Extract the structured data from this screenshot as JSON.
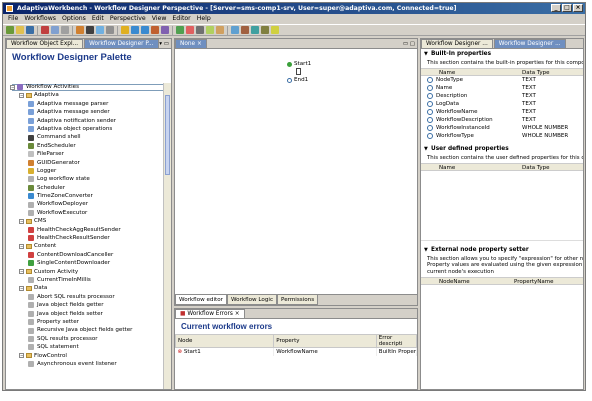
{
  "window": {
    "title": "AdaptivaWorkbench - Workflow Designer Perspective - [Server=sms-comp1-srv, User=super@adaptiva.com, Connected=true]",
    "controls": [
      "_",
      "□",
      "×"
    ]
  },
  "menu": [
    "File",
    "Workflows",
    "Options",
    "Edit",
    "Perspective",
    "View",
    "Editor",
    "Help"
  ],
  "left_panel": {
    "tabs": [
      "Workflow Object Expl...",
      "Workflow Designer P..."
    ],
    "palette_title": "Workflow Designer Palette",
    "tree": [
      {
        "label": "Workflow Activities",
        "level": 0,
        "type": "root",
        "color": "#8a6cc0"
      },
      {
        "label": "Adaptiva",
        "level": 1,
        "type": "folder"
      },
      {
        "label": "Adaptiva message parser",
        "level": 2,
        "type": "item",
        "color": "#7aa0d8"
      },
      {
        "label": "Adaptiva message sender",
        "level": 2,
        "type": "item",
        "color": "#7aa0d8"
      },
      {
        "label": "Adaptiva notification sender",
        "level": 2,
        "type": "item",
        "color": "#7aa0d8"
      },
      {
        "label": "Adaptiva object operations",
        "level": 2,
        "type": "item",
        "color": "#7aa0d8"
      },
      {
        "label": "Command shell",
        "level": 2,
        "type": "item",
        "color": "#404040"
      },
      {
        "label": "EndScheduler",
        "level": 2,
        "type": "item",
        "color": "#6a8a3a"
      },
      {
        "label": "FileParser",
        "level": 2,
        "type": "item",
        "color": "#c0c0c0"
      },
      {
        "label": "GUIDGenerator",
        "level": 2,
        "type": "item",
        "color": "#d08030"
      },
      {
        "label": "Logger",
        "level": 2,
        "type": "item",
        "color": "#d8b030"
      },
      {
        "label": "Log workflow state",
        "level": 2,
        "type": "item",
        "color": "#b0b0b0"
      },
      {
        "label": "Scheduler",
        "level": 2,
        "type": "item",
        "color": "#6a8a3a"
      },
      {
        "label": "TimeZoneConverter",
        "level": 2,
        "type": "item",
        "color": "#3a8ad0"
      },
      {
        "label": "WorkflowDeployer",
        "level": 2,
        "type": "item",
        "color": "#b0b0b0"
      },
      {
        "label": "WorkflowExecutor",
        "level": 2,
        "type": "item",
        "color": "#b0b0b0"
      },
      {
        "label": "CMS",
        "level": 1,
        "type": "folder"
      },
      {
        "label": "HealthCheckAggResultSender",
        "level": 2,
        "type": "item",
        "color": "#d04040"
      },
      {
        "label": "HealthCheckResultSender",
        "level": 2,
        "type": "item",
        "color": "#d04040"
      },
      {
        "label": "Content",
        "level": 1,
        "type": "folder"
      },
      {
        "label": "ContentDownloadCanceller",
        "level": 2,
        "type": "item",
        "color": "#d04040"
      },
      {
        "label": "SingleContentDownloader",
        "level": 2,
        "type": "item",
        "color": "#40a040"
      },
      {
        "label": "Custom Activity",
        "level": 1,
        "type": "folder"
      },
      {
        "label": "CurrentTimeInMillis",
        "level": 2,
        "type": "item",
        "color": "#b0b0b0"
      },
      {
        "label": "Data",
        "level": 1,
        "type": "folder"
      },
      {
        "label": "Abort SQL results processor",
        "level": 2,
        "type": "item",
        "color": "#b0b0b0"
      },
      {
        "label": "Java object fields getter",
        "level": 2,
        "type": "item",
        "color": "#b0b0b0"
      },
      {
        "label": "Java object fields setter",
        "level": 2,
        "type": "item",
        "color": "#b0b0b0"
      },
      {
        "label": "Property setter",
        "level": 2,
        "type": "item",
        "color": "#b0b0b0"
      },
      {
        "label": "Recursive Java object fields getter",
        "level": 2,
        "type": "item",
        "color": "#b0b0b0"
      },
      {
        "label": "SQL results processor",
        "level": 2,
        "type": "item",
        "color": "#b0b0b0"
      },
      {
        "label": "SQL statement",
        "level": 2,
        "type": "item",
        "color": "#b0b0b0"
      },
      {
        "label": "FlowControl",
        "level": 1,
        "type": "folder"
      },
      {
        "label": "Asynchronous event listener",
        "level": 2,
        "type": "item",
        "color": "#b0b0b0"
      }
    ]
  },
  "editor": {
    "tab": "None",
    "nodes": [
      {
        "label": "Start1",
        "color": "#3aa03a"
      },
      {
        "label": "End1",
        "color": "#3a6ea5"
      }
    ],
    "bottom_tabs": [
      "Workflow editor",
      "Workflow Logic",
      "Permissions"
    ]
  },
  "errors": {
    "tab": "Workflow Errors",
    "title": "Current workflow errors",
    "columns": [
      "Node",
      "Property",
      "Error descripti"
    ],
    "rows": [
      {
        "node": "Start1",
        "property": "WorkflowName",
        "error": "BuiltIn Proper"
      }
    ]
  },
  "right_panel": {
    "tabs": [
      "Workflow Designer ...",
      "Workflow Designer ..."
    ],
    "builtin": {
      "title": "Built-In properties",
      "desc": "This section contains the built-in properties for this component",
      "columns": [
        "Name",
        "Data Type"
      ],
      "rows": [
        {
          "name": "NodeType",
          "type": "TEXT"
        },
        {
          "name": "Name",
          "type": "TEXT"
        },
        {
          "name": "Description",
          "type": "TEXT"
        },
        {
          "name": "LogData",
          "type": "TEXT"
        },
        {
          "name": "WorkflowName",
          "type": "TEXT"
        },
        {
          "name": "WorkflowDescription",
          "type": "TEXT"
        },
        {
          "name": "WorkflowInstanceId",
          "type": "WHOLE NUMBER"
        },
        {
          "name": "WorkflowType",
          "type": "WHOLE NUMBER"
        }
      ]
    },
    "user_defined": {
      "title": "User defined properties",
      "desc": "This section contains the user defined properties for this compo",
      "columns": [
        "Name",
        "Data Type"
      ]
    },
    "external": {
      "title": "External node property setter",
      "desc_lines": [
        "This section allows you to specify \"expression\" for other nodes",
        "Property values are evaluated using the given expression just I",
        "current node's execution"
      ],
      "columns": [
        "NodeName",
        "PropertyName"
      ]
    }
  }
}
